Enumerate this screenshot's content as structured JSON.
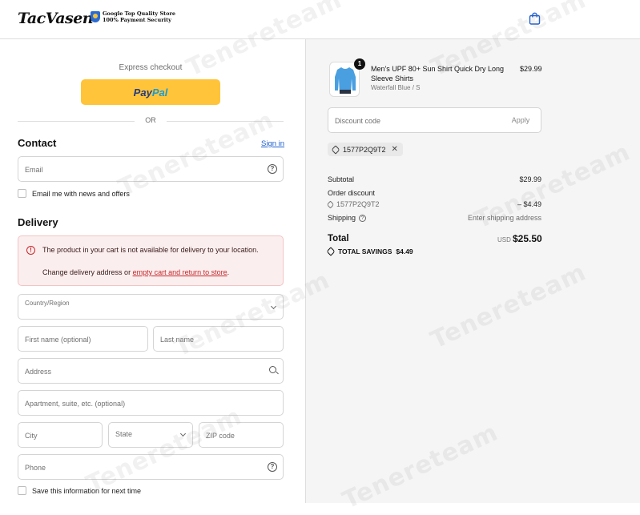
{
  "header": {
    "logo": "TacVasen",
    "badge_line1": "Google Top Quality Store",
    "badge_line2": "100% Payment Security"
  },
  "express": {
    "label": "Express checkout",
    "paypal_part1": "Pay",
    "paypal_part2": "Pal",
    "or": "OR"
  },
  "contact": {
    "title": "Contact",
    "signin": "Sign in",
    "email_placeholder": "Email",
    "newsletter_label": "Email me with news and offers"
  },
  "delivery": {
    "title": "Delivery",
    "alert_message": "The product in your cart is not available for delivery to your location.",
    "alert_change_prefix": "Change delivery address or ",
    "alert_link": "empty cart and return to store",
    "alert_suffix": ".",
    "country_placeholder": "Country/Region",
    "first_name_placeholder": "First name (optional)",
    "last_name_placeholder": "Last name",
    "address_placeholder": "Address",
    "apartment_placeholder": "Apartment, suite, etc. (optional)",
    "city_placeholder": "City",
    "state_placeholder": "State",
    "zip_placeholder": "ZIP code",
    "phone_placeholder": "Phone",
    "save_info_label": "Save this information for next time"
  },
  "order": {
    "quantity": "1",
    "product_name": "Men's UPF 80+ Sun Shirt Quick Dry Long Sleeve Shirts",
    "product_variant": "Waterfall Blue / S",
    "product_price": "$29.99",
    "discount_placeholder": "Discount code",
    "apply_label": "Apply",
    "applied_code": "1577P2Q9T2",
    "subtotal_label": "Subtotal",
    "subtotal_value": "$29.99",
    "order_discount_label": "Order discount",
    "discount_code": "1577P2Q9T2",
    "discount_value": "– $4.49",
    "shipping_label": "Shipping",
    "shipping_value": "Enter shipping address",
    "total_label": "Total",
    "total_currency": "USD",
    "total_value": "$25.50",
    "savings_label": "TOTAL SAVINGS",
    "savings_value": "$4.49"
  },
  "watermark": "Tenereteam",
  "colors": {
    "paypal_yellow": "#ffc439",
    "link_blue": "#1f5fcf",
    "alert_red": "#c5282c",
    "alert_bg": "#fbeeee",
    "summary_bg": "#f5f5f5"
  }
}
